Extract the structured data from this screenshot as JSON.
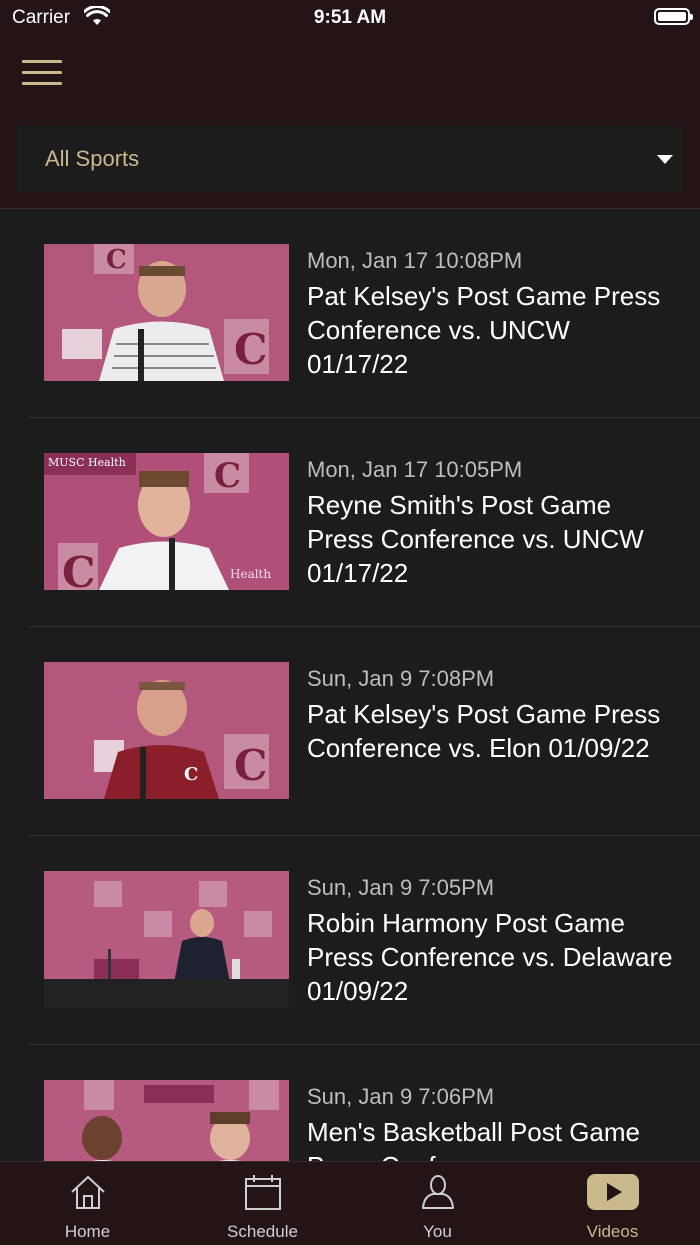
{
  "status_bar": {
    "carrier": "Carrier",
    "time": "9:51 AM"
  },
  "header": {
    "filter_value": "All Sports"
  },
  "videos": [
    {
      "date": "Mon, Jan 17 10:08PM",
      "title": "Pat Kelsey's Post Game Press Conference vs. UNCW 01/17/22"
    },
    {
      "date": "Mon, Jan 17 10:05PM",
      "title": "Reyne Smith's Post Game Press Conference vs. UNCW 01/17/22"
    },
    {
      "date": "Sun, Jan 9 7:08PM",
      "title": "Pat Kelsey's Post Game Press Conference vs. Elon 01/09/22"
    },
    {
      "date": "Sun, Jan 9 7:05PM",
      "title": "Robin Harmony Post Game Press Conference vs. Delaware 01/09/22"
    },
    {
      "date": "Sun, Jan 9 7:06PM",
      "title": "Men's Basketball Post Game Press Conference"
    }
  ],
  "tabs": [
    {
      "label": "Home",
      "icon": "home-icon"
    },
    {
      "label": "Schedule",
      "icon": "calendar-icon"
    },
    {
      "label": "You",
      "icon": "person-icon"
    },
    {
      "label": "Videos",
      "icon": "play-icon",
      "active": true
    }
  ],
  "colors": {
    "accent": "#cbb98e",
    "header_bg": "#231416",
    "list_bg": "#1c1c1c"
  }
}
